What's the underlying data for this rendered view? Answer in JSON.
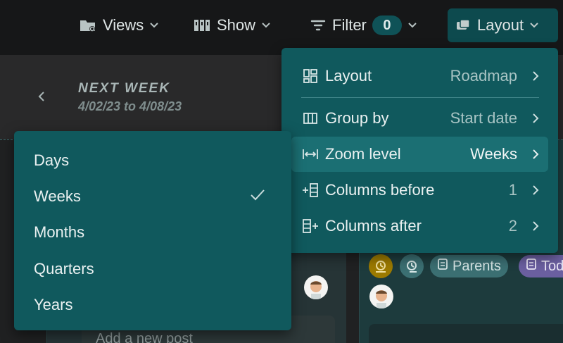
{
  "toolbar": {
    "views_label": "Views",
    "show_label": "Show",
    "filter_label": "Filter",
    "filter_count": "0",
    "layout_label": "Layout"
  },
  "week": {
    "title": "NEXT WEEK",
    "range": "4/02/23 to 4/08/23"
  },
  "layout_menu": {
    "items": [
      {
        "label": "Layout",
        "value": "Roadmap",
        "icon": "layout-grid-icon"
      },
      {
        "label": "Group by",
        "value": "Start date",
        "icon": "columns-icon"
      },
      {
        "label": "Zoom level",
        "value": "Weeks",
        "icon": "zoom-width-icon",
        "active": true
      },
      {
        "label": "Columns before",
        "value": "1",
        "icon": "add-column-before-icon"
      },
      {
        "label": "Columns after",
        "value": "2",
        "icon": "add-column-after-icon"
      }
    ]
  },
  "zoom_menu": {
    "items": [
      "Days",
      "Weeks",
      "Months",
      "Quarters",
      "Years"
    ],
    "selected": "Weeks"
  },
  "board": {
    "chip_parents": "Parents",
    "chip_todo": "Tod",
    "add_post": "Add a new post"
  },
  "colors": {
    "menu_bg": "#10595d",
    "menu_active": "#1b6f73",
    "accent": "#0f5257",
    "todo_chip": "#6b5fa0",
    "timer_chip": "#9c7a00"
  }
}
